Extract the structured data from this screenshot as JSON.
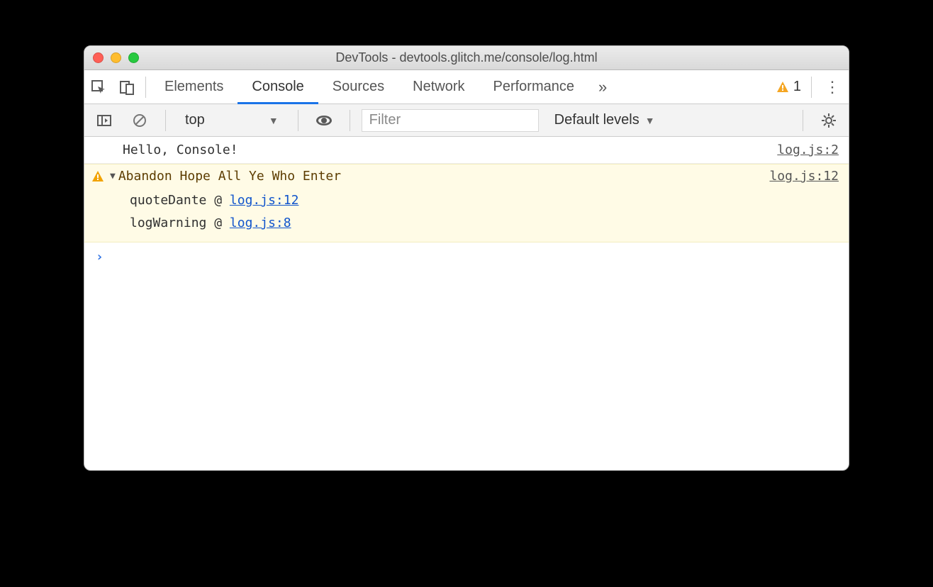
{
  "title": {
    "prefix": "DevTools - ",
    "url": "devtools.glitch.me/console/log.html"
  },
  "tabs": {
    "elements": "Elements",
    "console": "Console",
    "sources": "Sources",
    "network": "Network",
    "performance": "Performance"
  },
  "warnings_count": "1",
  "toolbar": {
    "context": "top",
    "filter_placeholder": "Filter",
    "levels": "Default levels"
  },
  "logs": {
    "info": {
      "message": "Hello, Console!",
      "source": "log.js:2"
    },
    "warn": {
      "message": "Abandon Hope All Ye Who Enter",
      "source": "log.js:12",
      "trace": [
        {
          "fn": "quoteDante",
          "at": "log.js:12"
        },
        {
          "fn": "logWarning",
          "at": "log.js:8"
        }
      ]
    }
  },
  "glyphs": {
    "chev_down": "▼",
    "more": "»",
    "kebab": "⋮",
    "prompt": "›",
    "disclose_open": "▼",
    "at": "@"
  }
}
